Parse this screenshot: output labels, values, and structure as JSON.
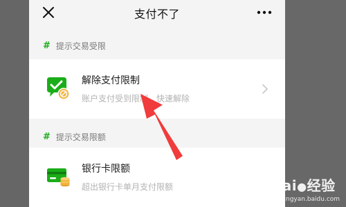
{
  "header": {
    "title": "支付不了"
  },
  "sections": [
    {
      "label": "提示交易受限",
      "item": {
        "title": "解除支付限制",
        "subtitle": "账户支付受到限制，快速解除"
      }
    },
    {
      "label": "提示交易限额",
      "item": {
        "title": "银行卡限额",
        "subtitle": "超出银行卡单月支付限额"
      }
    }
  ],
  "icons": {
    "close": "close-icon",
    "more": "more-dots-icon",
    "section_marker": "#",
    "unlock": "payment-unlock-icon",
    "bank_card": "bank-card-icon",
    "chevron": "chevron-right-icon"
  },
  "colors": {
    "accent": "#1aad19",
    "arrow": "#f03c3c",
    "page_bg": "#f4f4f4"
  },
  "watermark": {
    "brand": "Bai",
    "brand_suffix": "经验",
    "url": "jingyan.baidu.com"
  }
}
